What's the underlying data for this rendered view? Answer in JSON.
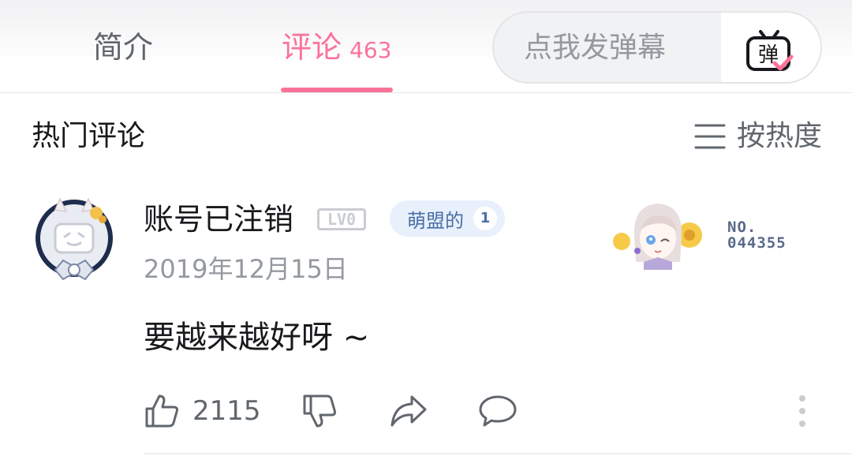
{
  "tabs": {
    "intro": "简介",
    "comments": "评论",
    "comments_count": "463"
  },
  "danmaku": {
    "placeholder": "点我发弹幕",
    "button_glyph": "弹"
  },
  "section": {
    "title": "热门评论",
    "sort_label": "按热度"
  },
  "comment": {
    "username": "账号已注销",
    "level_badge": "LV0",
    "fan_badge_name": "萌盟的",
    "fan_badge_level": "1",
    "date": "2019年12月15日",
    "decoration_no_label": "NO.",
    "decoration_no_value": "044355",
    "text": "要越来越好呀 ~",
    "likes": "2115"
  },
  "colors": {
    "accent": "#fb7299",
    "text": "#18191c",
    "secondary": "#61666d",
    "muted": "#9499a0",
    "fan_badge_bg": "#e8f0fc"
  }
}
